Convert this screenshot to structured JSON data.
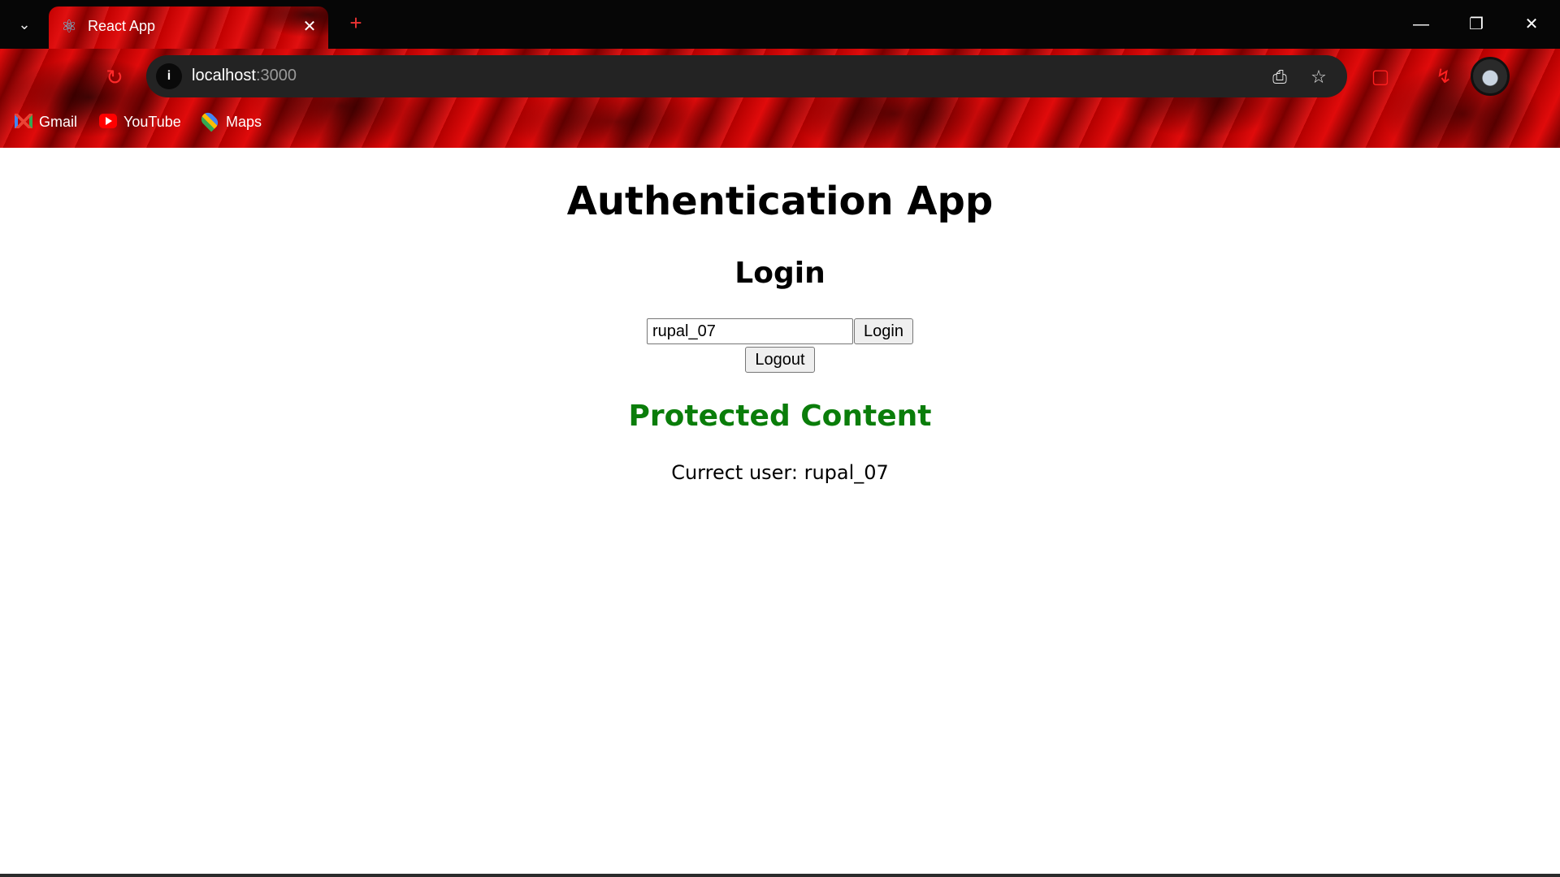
{
  "browser": {
    "tab_title": "React App",
    "url_host": "localhost",
    "url_port": ":3000",
    "bookmarks": [
      {
        "label": "Gmail",
        "icon": "gmail-icon"
      },
      {
        "label": "YouTube",
        "icon": "youtube-icon"
      },
      {
        "label": "Maps",
        "icon": "maps-icon"
      }
    ],
    "theme_color": "#c10000"
  },
  "app": {
    "title": "Authentication App",
    "login_heading": "Login",
    "username_value": "rupal_07",
    "login_label": "Login",
    "logout_label": "Logout",
    "protected_heading": "Protected Content",
    "current_user_text": "Currect user: rupal_07",
    "protected_color": "#0a7d0a"
  }
}
